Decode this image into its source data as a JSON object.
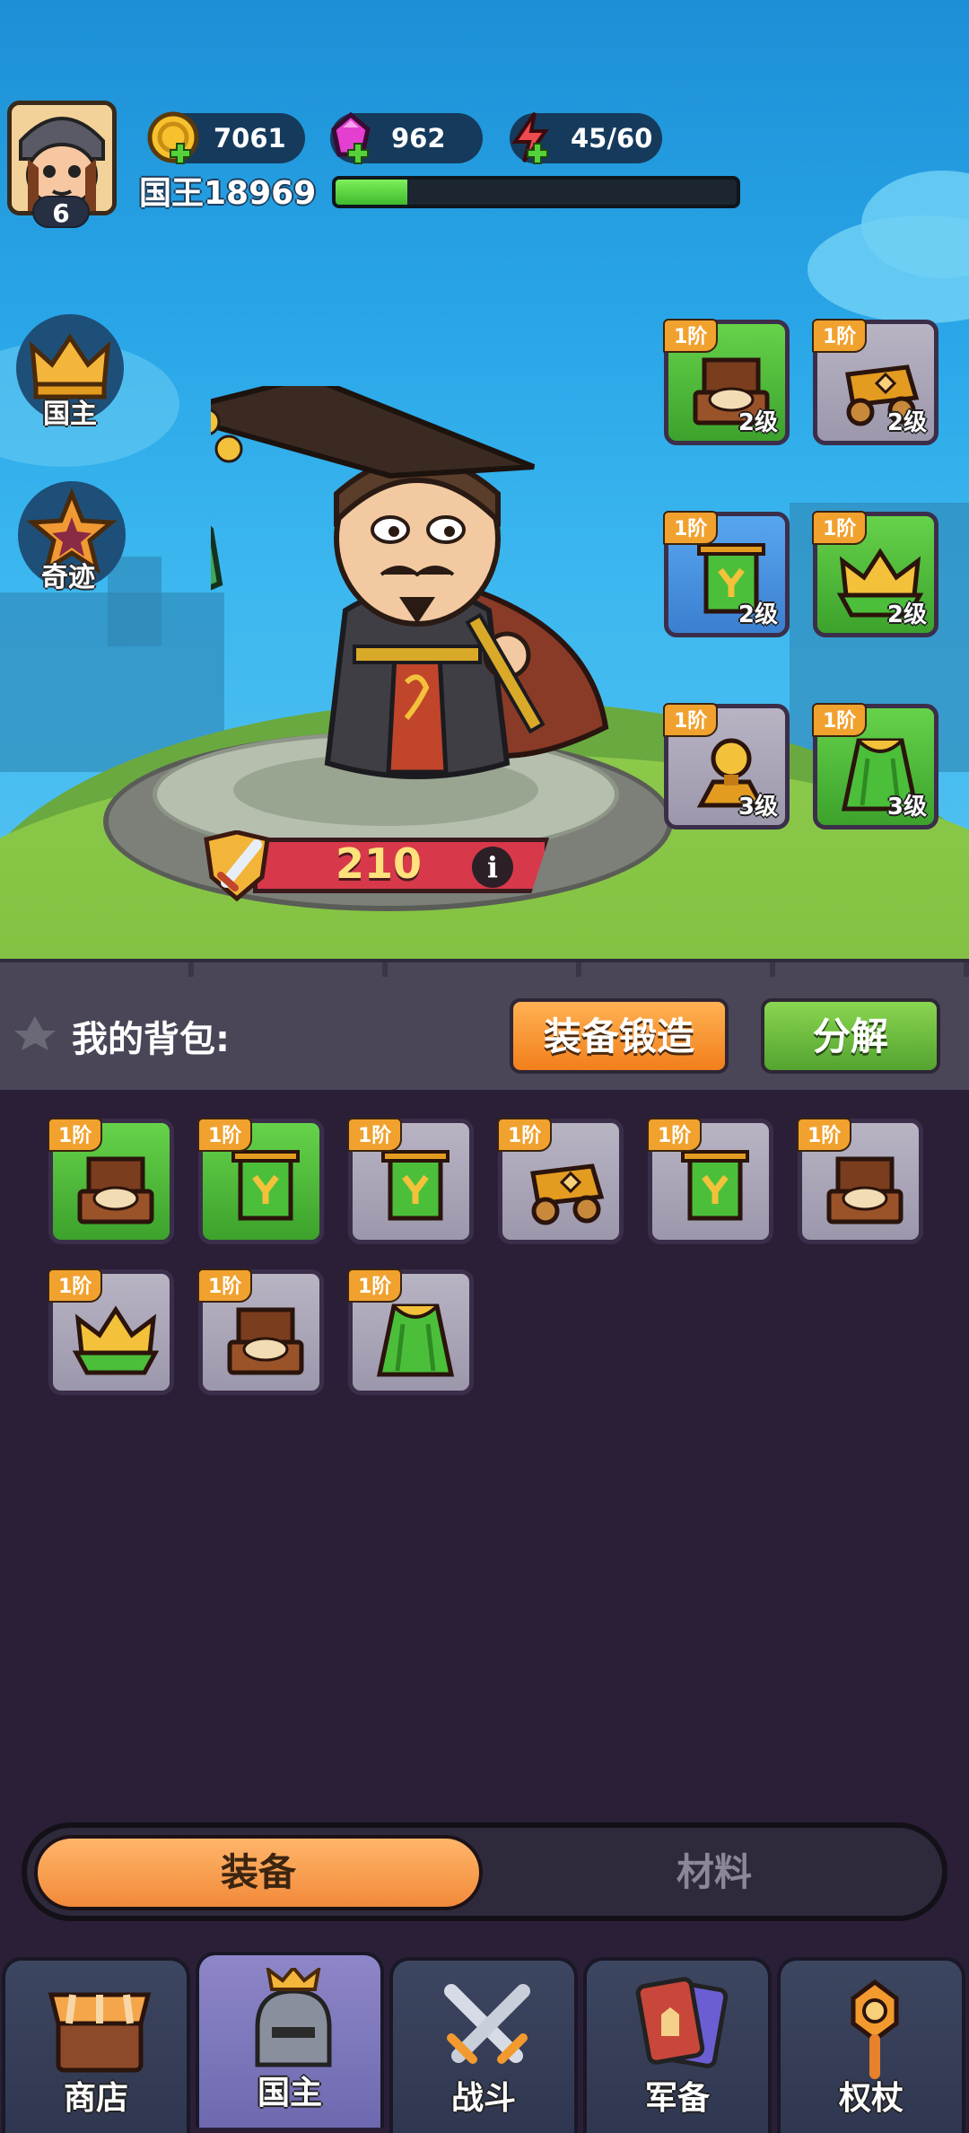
{
  "player": {
    "name": "国王18969",
    "level": "6",
    "xp_fraction": 0.18
  },
  "resources": [
    {
      "name": "gold",
      "value": "7061",
      "icon": "gold-coin-icon"
    },
    {
      "name": "gem",
      "value": "962",
      "icon": "gem-icon"
    },
    {
      "name": "energy",
      "value": "45/60",
      "icon": "lightning-icon"
    }
  ],
  "side_menu": [
    {
      "label": "国主",
      "icon": "crown-icon"
    },
    {
      "label": "奇迹",
      "icon": "star-badge-icon"
    }
  ],
  "equipped": [
    {
      "tier": "1阶",
      "level": "2级",
      "item": "throne",
      "rarity": "green"
    },
    {
      "tier": "1阶",
      "level": "2级",
      "item": "cart",
      "rarity": "grey"
    },
    {
      "tier": "1阶",
      "level": "2级",
      "item": "banner",
      "rarity": "blue"
    },
    {
      "tier": "1阶",
      "level": "2级",
      "item": "crown",
      "rarity": "green"
    },
    {
      "tier": "1阶",
      "level": "3级",
      "item": "orb-stand",
      "rarity": "grey"
    },
    {
      "tier": "1阶",
      "level": "3级",
      "item": "cape",
      "rarity": "green"
    }
  ],
  "power": {
    "value": "210"
  },
  "bag": {
    "title": "我的背包:",
    "forge_label": "装备锻造",
    "decompose_label": "分解",
    "items": [
      {
        "tier": "1阶",
        "item": "throne",
        "rarity": "green"
      },
      {
        "tier": "1阶",
        "item": "banner",
        "rarity": "green"
      },
      {
        "tier": "1阶",
        "item": "banner",
        "rarity": "grey"
      },
      {
        "tier": "1阶",
        "item": "cart",
        "rarity": "grey"
      },
      {
        "tier": "1阶",
        "item": "banner",
        "rarity": "grey"
      },
      {
        "tier": "1阶",
        "item": "throne",
        "rarity": "grey"
      },
      {
        "tier": "1阶",
        "item": "crown",
        "rarity": "grey"
      },
      {
        "tier": "1阶",
        "item": "throne",
        "rarity": "grey"
      },
      {
        "tier": "1阶",
        "item": "cape",
        "rarity": "grey"
      }
    ]
  },
  "category_tabs": {
    "equipment": "装备",
    "materials": "材料",
    "active": "equipment"
  },
  "nav": [
    {
      "label": "商店",
      "icon": "shop-icon"
    },
    {
      "label": "国主",
      "icon": "helmet-crown-icon",
      "active": true
    },
    {
      "label": "战斗",
      "icon": "crossed-swords-icon"
    },
    {
      "label": "军备",
      "icon": "cards-icon"
    },
    {
      "label": "权杖",
      "icon": "scepter-icon"
    }
  ],
  "colors": {
    "gold": "#f1a12d",
    "green_rarity": "#4fbc38",
    "blue_rarity": "#4a90e0",
    "grey_rarity": "#aaa6b8",
    "accent_orange": "#f28a3a"
  }
}
